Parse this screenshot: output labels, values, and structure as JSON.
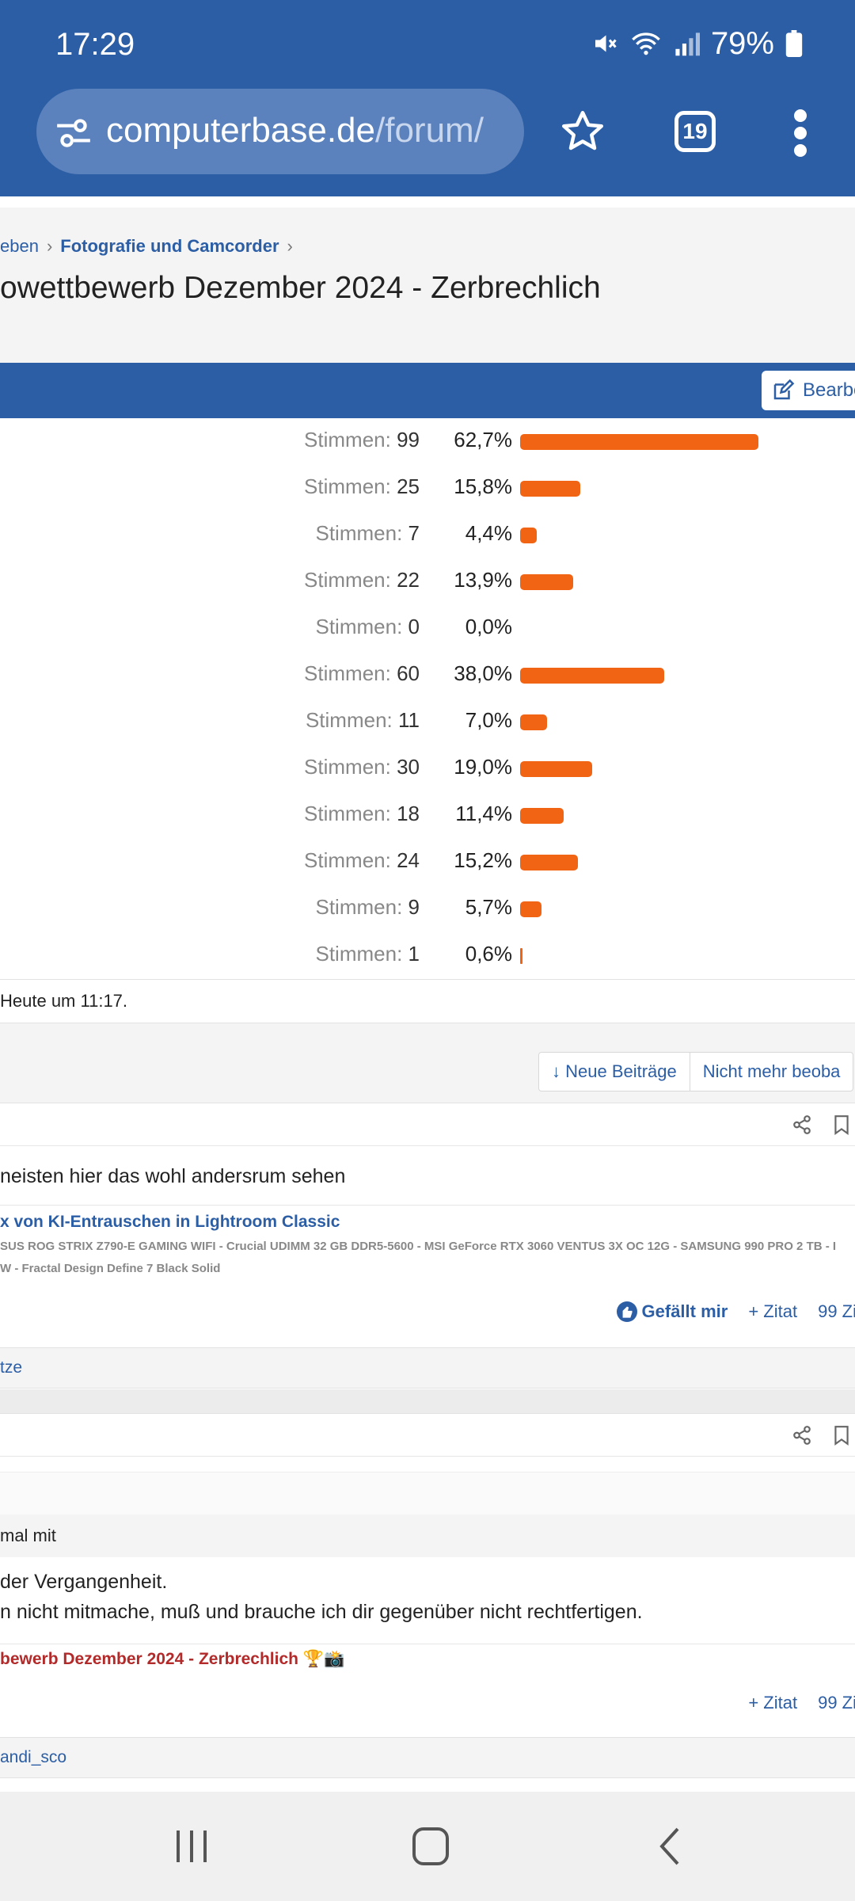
{
  "status_bar": {
    "time": "17:29",
    "battery": "79%"
  },
  "browser": {
    "url_host": "computerbase.de",
    "url_path": "/forum/",
    "tab_count": "19"
  },
  "breadcrumb": {
    "item1": "eben",
    "item2": "Fotografie und Camcorder"
  },
  "thread_title": "owettbewerb Dezember 2024 - Zerbrechlich",
  "toolbar": {
    "edit_label": "Bearbe"
  },
  "poll": {
    "votes_label": "Stimmen:",
    "rows": [
      {
        "votes": "99",
        "percent": "62,7%",
        "share": 62.7
      },
      {
        "votes": "25",
        "percent": "15,8%",
        "share": 15.8
      },
      {
        "votes": "7",
        "percent": "4,4%",
        "share": 4.4
      },
      {
        "votes": "22",
        "percent": "13,9%",
        "share": 13.9
      },
      {
        "votes": "0",
        "percent": "0,0%",
        "share": 0
      },
      {
        "votes": "60",
        "percent": "38,0%",
        "share": 38.0
      },
      {
        "votes": "11",
        "percent": "7,0%",
        "share": 7.0
      },
      {
        "votes": "30",
        "percent": "19,0%",
        "share": 19.0
      },
      {
        "votes": "18",
        "percent": "11,4%",
        "share": 11.4
      },
      {
        "votes": "24",
        "percent": "15,2%",
        "share": 15.2
      },
      {
        "votes": "9",
        "percent": "5,7%",
        "share": 5.7
      },
      {
        "votes": "1",
        "percent": "0,6%",
        "share": 0.6
      }
    ],
    "footer": "Heute um 11:17."
  },
  "thread_buttons": {
    "new_posts": "↓ Neue Beiträge",
    "unwatch": "Nicht mehr beoba"
  },
  "post1": {
    "text": "neisten hier das wohl andersrum sehen",
    "sig_title": "x von KI-Entrauschen in Lightroom Classic",
    "sig_line1": "SUS ROG STRIX Z790-E GAMING WIFI - Crucial UDIMM 32 GB DDR5-5600 - MSI GeForce RTX 3060 VENTUS 3X OC 12G - SAMSUNG 990 PRO 2 TB - I",
    "sig_line2": "W - Fractal Design Define 7 Black Solid",
    "like": "Gefällt mir",
    "quote": "+ Zitat",
    "multiquote": "99 Zi",
    "likes_by": "tze"
  },
  "post2": {
    "quote_header": "mal mit",
    "text_line1": " der Vergangenheit.",
    "text_line2": "n nicht mitmache, muß und brauche ich dir gegenüber nicht rechtfertigen.",
    "thread_link": "bewerb Dezember 2024 - Zerbrechlich 🏆📸",
    "quote": "+ Zitat",
    "multiquote": "99 Zi",
    "likes_by": "andi_sco"
  },
  "colors": {
    "brand_blue": "#2c5ea5",
    "bar_orange": "#f06414"
  }
}
